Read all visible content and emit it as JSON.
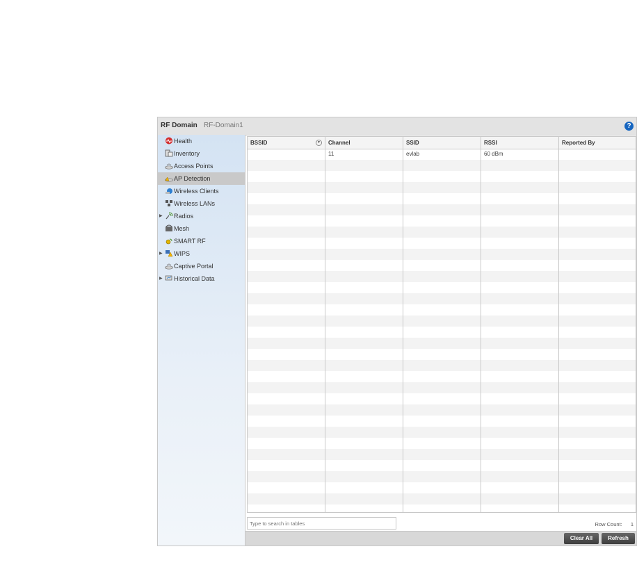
{
  "header": {
    "title": "RF Domain",
    "subtitle": "RF-Domain1",
    "help_label": "?"
  },
  "sidebar": {
    "items": [
      {
        "label": "Health",
        "icon": "health-icon"
      },
      {
        "label": "Inventory",
        "icon": "inventory-icon"
      },
      {
        "label": "Access Points",
        "icon": "access-points-icon"
      },
      {
        "label": "AP Detection",
        "icon": "ap-detection-icon",
        "active": true
      },
      {
        "label": "Wireless Clients",
        "icon": "wireless-clients-icon"
      },
      {
        "label": "Wireless LANs",
        "icon": "wireless-lans-icon"
      },
      {
        "label": "Radios",
        "icon": "radios-icon",
        "expandable": true
      },
      {
        "label": "Mesh",
        "icon": "mesh-icon"
      },
      {
        "label": "SMART RF",
        "icon": "smart-rf-icon"
      },
      {
        "label": "WIPS",
        "icon": "wips-icon",
        "expandable": true
      },
      {
        "label": "Captive Portal",
        "icon": "captive-portal-icon"
      },
      {
        "label": "Historical Data",
        "icon": "historical-data-icon",
        "expandable": true
      }
    ]
  },
  "table": {
    "columns": [
      "BSSID",
      "Channel",
      "SSID",
      "RSSI",
      "Reported By"
    ],
    "rows": [
      {
        "bssid": "",
        "channel": "11",
        "ssid": "evlab",
        "rssi": "60 dBm",
        "reported_by": ""
      }
    ]
  },
  "footer": {
    "search_placeholder": "Type to search in tables",
    "row_count_label": "Row Count:",
    "row_count_value": "1",
    "clear_all_label": "Clear All",
    "refresh_label": "Refresh"
  },
  "colors": {
    "help_icon": "#1565c0",
    "sidebar_active": "#c9c9c9",
    "button": "#4a4a4a"
  }
}
